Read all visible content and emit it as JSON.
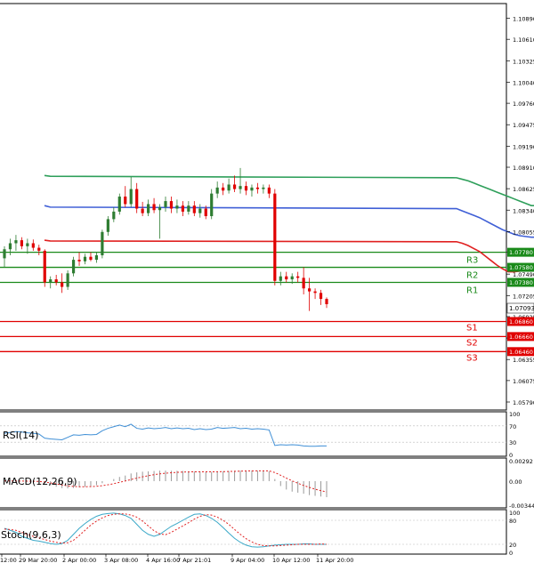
{
  "colors": {
    "background": "#ffffff",
    "frame": "#000000",
    "up_candle": "#2e7d32",
    "down_candle": "#e00000",
    "ma_green": "#2e9f5a",
    "ma_blue": "#3f5fd6",
    "ma_red": "#e02020",
    "resistance": "#1a8a1a",
    "support": "#e00000",
    "rsi": "#3f8fd6",
    "macd_hist": "#999999",
    "macd_signal": "#e02020",
    "stoch_main": "#3aa8c8",
    "stoch_signal": "#e02020"
  },
  "price_axis": {
    "ticks": [
      "1.10890",
      "1.10610",
      "1.10325",
      "1.10040",
      "1.09760",
      "1.09475",
      "1.09190",
      "1.08910",
      "1.08625",
      "1.08340",
      "1.08055",
      "1.07780",
      "1.07490",
      "1.07205",
      "1.06925",
      "1.06640",
      "1.06355",
      "1.06075",
      "1.05790"
    ],
    "current_price": "1.07093"
  },
  "levels": [
    {
      "name": "R3",
      "price": "1.07780",
      "kind": "resistance"
    },
    {
      "name": "R2",
      "price": "1.07580",
      "kind": "resistance"
    },
    {
      "name": "R1",
      "price": "1.07380",
      "kind": "resistance"
    },
    {
      "name": "S1",
      "price": "1.06860",
      "kind": "support"
    },
    {
      "name": "S2",
      "price": "1.06660",
      "kind": "support"
    },
    {
      "name": "S3",
      "price": "1.06460",
      "kind": "support"
    }
  ],
  "time_axis": [
    "12:00",
    "29 Mar 20:00",
    "2 Apr 00:00",
    "3 Apr 08:00",
    "4 Apr 16:00",
    "7 Apr 21:01",
    "9 Apr 04:00",
    "10 Apr 12:00",
    "11 Apr 20:00"
  ],
  "indicators": {
    "rsi": {
      "label": "RSI(14)",
      "ticks": [
        "100",
        "70",
        "30",
        "0"
      ]
    },
    "macd": {
      "label": "MACD(12,26,9)",
      "ticks": [
        "0.00292",
        "0.00",
        "-0.00344"
      ]
    },
    "stoch": {
      "label": "Stoch(9,6,3)",
      "ticks": [
        "100",
        "80",
        "20",
        "0"
      ]
    }
  },
  "chart_data": {
    "type": "candlestick",
    "ylim": [
      1.0579,
      1.1089
    ],
    "candles": [
      {
        "o": 1.077,
        "h": 1.0786,
        "l": 1.0758,
        "c": 1.0782
      },
      {
        "o": 1.0782,
        "h": 1.0796,
        "l": 1.0774,
        "c": 1.079
      },
      {
        "o": 1.079,
        "h": 1.0801,
        "l": 1.078,
        "c": 1.0794
      },
      {
        "o": 1.0794,
        "h": 1.0798,
        "l": 1.0782,
        "c": 1.0786
      },
      {
        "o": 1.0786,
        "h": 1.0796,
        "l": 1.0776,
        "c": 1.079
      },
      {
        "o": 1.079,
        "h": 1.0795,
        "l": 1.078,
        "c": 1.0784
      },
      {
        "o": 1.0784,
        "h": 1.0788,
        "l": 1.0774,
        "c": 1.078
      },
      {
        "o": 1.078,
        "h": 1.0782,
        "l": 1.0732,
        "c": 1.0738
      },
      {
        "o": 1.0738,
        "h": 1.0746,
        "l": 1.073,
        "c": 1.0742
      },
      {
        "o": 1.0742,
        "h": 1.0748,
        "l": 1.0734,
        "c": 1.0738
      },
      {
        "o": 1.0738,
        "h": 1.075,
        "l": 1.0724,
        "c": 1.0732
      },
      {
        "o": 1.0732,
        "h": 1.0754,
        "l": 1.0728,
        "c": 1.075
      },
      {
        "o": 1.075,
        "h": 1.0772,
        "l": 1.0746,
        "c": 1.0768
      },
      {
        "o": 1.0768,
        "h": 1.0778,
        "l": 1.076,
        "c": 1.0766
      },
      {
        "o": 1.0766,
        "h": 1.0776,
        "l": 1.0762,
        "c": 1.0772
      },
      {
        "o": 1.0772,
        "h": 1.0778,
        "l": 1.0766,
        "c": 1.0768
      },
      {
        "o": 1.0768,
        "h": 1.0778,
        "l": 1.0764,
        "c": 1.0774
      },
      {
        "o": 1.0774,
        "h": 1.0808,
        "l": 1.077,
        "c": 1.0805
      },
      {
        "o": 1.0805,
        "h": 1.0826,
        "l": 1.08,
        "c": 1.0822
      },
      {
        "o": 1.0822,
        "h": 1.0838,
        "l": 1.0818,
        "c": 1.0832
      },
      {
        "o": 1.0832,
        "h": 1.0856,
        "l": 1.0828,
        "c": 1.0852
      },
      {
        "o": 1.0852,
        "h": 1.0866,
        "l": 1.0838,
        "c": 1.0842
      },
      {
        "o": 1.0842,
        "h": 1.0878,
        "l": 1.0838,
        "c": 1.0862
      },
      {
        "o": 1.0862,
        "h": 1.087,
        "l": 1.083,
        "c": 1.0836
      },
      {
        "o": 1.0836,
        "h": 1.0845,
        "l": 1.0826,
        "c": 1.083
      },
      {
        "o": 1.083,
        "h": 1.0848,
        "l": 1.0826,
        "c": 1.0842
      },
      {
        "o": 1.0842,
        "h": 1.085,
        "l": 1.083,
        "c": 1.0834
      },
      {
        "o": 1.0834,
        "h": 1.0842,
        "l": 1.0796,
        "c": 1.0838
      },
      {
        "o": 1.0838,
        "h": 1.0852,
        "l": 1.0832,
        "c": 1.0846
      },
      {
        "o": 1.0846,
        "h": 1.0852,
        "l": 1.083,
        "c": 1.0836
      },
      {
        "o": 1.0836,
        "h": 1.0848,
        "l": 1.083,
        "c": 1.084
      },
      {
        "o": 1.084,
        "h": 1.0846,
        "l": 1.0826,
        "c": 1.0832
      },
      {
        "o": 1.0832,
        "h": 1.0846,
        "l": 1.0828,
        "c": 1.084
      },
      {
        "o": 1.084,
        "h": 1.0846,
        "l": 1.0826,
        "c": 1.083
      },
      {
        "o": 1.083,
        "h": 1.0842,
        "l": 1.0824,
        "c": 1.0836
      },
      {
        "o": 1.0836,
        "h": 1.084,
        "l": 1.0822,
        "c": 1.0826
      },
      {
        "o": 1.0826,
        "h": 1.0862,
        "l": 1.0822,
        "c": 1.0856
      },
      {
        "o": 1.0856,
        "h": 1.0872,
        "l": 1.085,
        "c": 1.0864
      },
      {
        "o": 1.0864,
        "h": 1.087,
        "l": 1.0854,
        "c": 1.086
      },
      {
        "o": 1.086,
        "h": 1.0876,
        "l": 1.0856,
        "c": 1.0868
      },
      {
        "o": 1.0868,
        "h": 1.088,
        "l": 1.0858,
        "c": 1.0862
      },
      {
        "o": 1.0862,
        "h": 1.089,
        "l": 1.0856,
        "c": 1.0866
      },
      {
        "o": 1.0866,
        "h": 1.0872,
        "l": 1.0854,
        "c": 1.086
      },
      {
        "o": 1.086,
        "h": 1.0868,
        "l": 1.0852,
        "c": 1.0864
      },
      {
        "o": 1.0864,
        "h": 1.087,
        "l": 1.0856,
        "c": 1.0862
      },
      {
        "o": 1.0862,
        "h": 1.0868,
        "l": 1.0856,
        "c": 1.0864
      },
      {
        "o": 1.0864,
        "h": 1.0868,
        "l": 1.085,
        "c": 1.0856
      },
      {
        "o": 1.0856,
        "h": 1.0862,
        "l": 1.0734,
        "c": 1.074
      },
      {
        "o": 1.074,
        "h": 1.0752,
        "l": 1.0734,
        "c": 1.0746
      },
      {
        "o": 1.0746,
        "h": 1.0752,
        "l": 1.0738,
        "c": 1.0742
      },
      {
        "o": 1.0742,
        "h": 1.075,
        "l": 1.0736,
        "c": 1.0746
      },
      {
        "o": 1.0746,
        "h": 1.0752,
        "l": 1.0738,
        "c": 1.0744
      },
      {
        "o": 1.0744,
        "h": 1.0758,
        "l": 1.0722,
        "c": 1.073
      },
      {
        "o": 1.073,
        "h": 1.0744,
        "l": 1.07,
        "c": 1.0726
      },
      {
        "o": 1.0726,
        "h": 1.073,
        "l": 1.0716,
        "c": 1.0724
      },
      {
        "o": 1.0724,
        "h": 1.0728,
        "l": 1.0708,
        "c": 1.0716
      },
      {
        "o": 1.0716,
        "h": 1.0718,
        "l": 1.0704,
        "c": 1.0709
      }
    ],
    "ma_green": [
      1.088,
      1.0879,
      1.0877,
      1.0875,
      1.0873,
      1.087,
      1.0867,
      1.0864,
      1.0861,
      1.0858,
      1.0855,
      1.0852,
      1.0849,
      1.0846,
      1.0843,
      1.084,
      1.0838,
      1.0836,
      1.0834,
      1.0833,
      1.0832,
      1.0832,
      1.0832,
      1.0832,
      1.0832,
      1.0832,
      1.0832,
      1.0832,
      1.0832,
      1.0832,
      1.0832,
      1.0832,
      1.0831,
      1.0831,
      1.083,
      1.083,
      1.083,
      1.0829,
      1.0829,
      1.0828,
      1.0827,
      1.0827,
      1.0826,
      1.0826,
      1.0825,
      1.0825,
      1.0824,
      1.0823,
      1.0821,
      1.0819,
      1.0817,
      1.0815,
      1.0813,
      1.0811,
      1.0809,
      1.0807,
      1.0805
    ],
    "ma_blue": [
      1.084,
      1.0838,
      1.0836,
      1.0833,
      1.083,
      1.0827,
      1.0824,
      1.082,
      1.0816,
      1.0812,
      1.0808,
      1.0805,
      1.0802,
      1.08,
      1.0799,
      1.0798,
      1.0798,
      1.0798,
      1.0799,
      1.08,
      1.0801,
      1.0802,
      1.0803,
      1.0803,
      1.0803,
      1.0803,
      1.0803,
      1.0803,
      1.0803,
      1.0803,
      1.0803,
      1.0803,
      1.0803,
      1.0803,
      1.0803,
      1.0803,
      1.0804,
      1.0805,
      1.0806,
      1.0807,
      1.0808,
      1.0809,
      1.081,
      1.0812,
      1.0814,
      1.0815,
      1.0814,
      1.0812,
      1.081,
      1.0808,
      1.0808,
      1.0807,
      1.0806,
      1.0806,
      1.0805,
      1.0805,
      1.0805
    ],
    "ma_red": [
      1.0794,
      1.0793,
      1.0792,
      1.079,
      1.0787,
      1.0783,
      1.0779,
      1.0773,
      1.0767,
      1.0761,
      1.0756,
      1.0752,
      1.0752,
      1.0753,
      1.0755,
      1.0757,
      1.0759,
      1.0762,
      1.0768,
      1.0776,
      1.0785,
      1.0794,
      1.0802,
      1.081,
      1.0816,
      1.0821,
      1.0826,
      1.083,
      1.0833,
      1.0835,
      1.0836,
      1.0836,
      1.0837,
      1.0838,
      1.0839,
      1.084,
      1.0842,
      1.0845,
      1.0848,
      1.085,
      1.0852,
      1.0853,
      1.0854,
      1.0854,
      1.0855,
      1.0855,
      1.0855,
      1.0853,
      1.0848,
      1.0838,
      1.0826,
      1.0814,
      1.0805,
      1.0797,
      1.079,
      1.0786,
      1.0782
    ],
    "rsi": [
      52,
      54,
      56,
      55,
      53,
      52,
      50,
      40,
      38,
      37,
      36,
      42,
      48,
      47,
      49,
      48,
      49,
      58,
      64,
      68,
      72,
      68,
      74,
      64,
      62,
      65,
      63,
      64,
      66,
      63,
      65,
      63,
      64,
      61,
      63,
      61,
      62,
      66,
      64,
      65,
      66,
      63,
      64,
      62,
      63,
      62,
      60,
      22,
      24,
      23,
      24,
      23,
      21,
      20,
      20,
      21,
      21
    ],
    "macd_hist": [
      5e-05,
      4e-05,
      3e-05,
      1e-05,
      -2e-05,
      -6e-05,
      -0.0001,
      -0.0003,
      -0.0006,
      -0.0008,
      -0.001,
      -0.00104,
      -0.00098,
      -0.0009,
      -0.0008,
      -0.0007,
      -0.00058,
      -0.0003,
      0.0,
      0.0003,
      0.0006,
      0.0008,
      0.0011,
      0.00125,
      0.00135,
      0.0014,
      0.00145,
      0.0015,
      0.0015,
      0.00148,
      0.00148,
      0.00145,
      0.0014,
      0.00138,
      0.00135,
      0.0013,
      0.00132,
      0.00138,
      0.00142,
      0.00146,
      0.0015,
      0.00152,
      0.00153,
      0.00152,
      0.0015,
      0.00148,
      0.0014,
      0.0003,
      -0.0007,
      -0.0012,
      -0.0015,
      -0.00165,
      -0.0018,
      -0.002,
      -0.0021,
      -0.0022,
      -0.0023
    ],
    "macd_signal": [
      3e-05,
      3e-05,
      2e-05,
      1e-05,
      0.0,
      -2e-05,
      -4e-05,
      -0.00012,
      -0.00025,
      -0.0004,
      -0.00055,
      -0.00068,
      -0.00076,
      -0.0008,
      -0.0008,
      -0.00078,
      -0.00074,
      -0.00065,
      -0.00052,
      -0.00036,
      -0.00017,
      2e-05,
      0.00023,
      0.00043,
      0.00062,
      0.00078,
      0.00092,
      0.00104,
      0.00113,
      0.0012,
      0.00126,
      0.0013,
      0.00132,
      0.00133,
      0.00134,
      0.00133,
      0.00133,
      0.00134,
      0.00136,
      0.00138,
      0.0014,
      0.00143,
      0.00145,
      0.00146,
      0.00147,
      0.00147,
      0.00146,
      0.00123,
      0.00084,
      0.00043,
      4e-05,
      -0.0003,
      -0.00062,
      -0.0009,
      -0.00115,
      -0.00136,
      -0.00155
    ],
    "stoch_main": [
      60,
      55,
      50,
      40,
      35,
      30,
      28,
      25,
      22,
      20,
      22,
      30,
      45,
      60,
      72,
      82,
      90,
      95,
      97,
      98,
      96,
      92,
      85,
      70,
      55,
      45,
      40,
      45,
      55,
      65,
      72,
      80,
      88,
      95,
      96,
      92,
      85,
      75,
      62,
      48,
      35,
      25,
      18,
      14,
      13,
      14,
      16,
      18,
      19,
      20,
      20,
      20,
      21,
      21,
      20,
      20,
      20
    ],
    "stoch_signal": [
      58,
      57,
      55,
      50,
      45,
      40,
      36,
      32,
      28,
      25,
      23,
      24,
      30,
      42,
      55,
      68,
      78,
      86,
      92,
      95,
      96,
      96,
      93,
      88,
      78,
      66,
      54,
      46,
      44,
      50,
      58,
      66,
      74,
      83,
      90,
      94,
      93,
      88,
      80,
      70,
      57,
      45,
      34,
      26,
      20,
      17,
      16,
      16,
      17,
      18,
      19,
      20,
      20,
      20,
      20,
      21,
      20
    ]
  }
}
